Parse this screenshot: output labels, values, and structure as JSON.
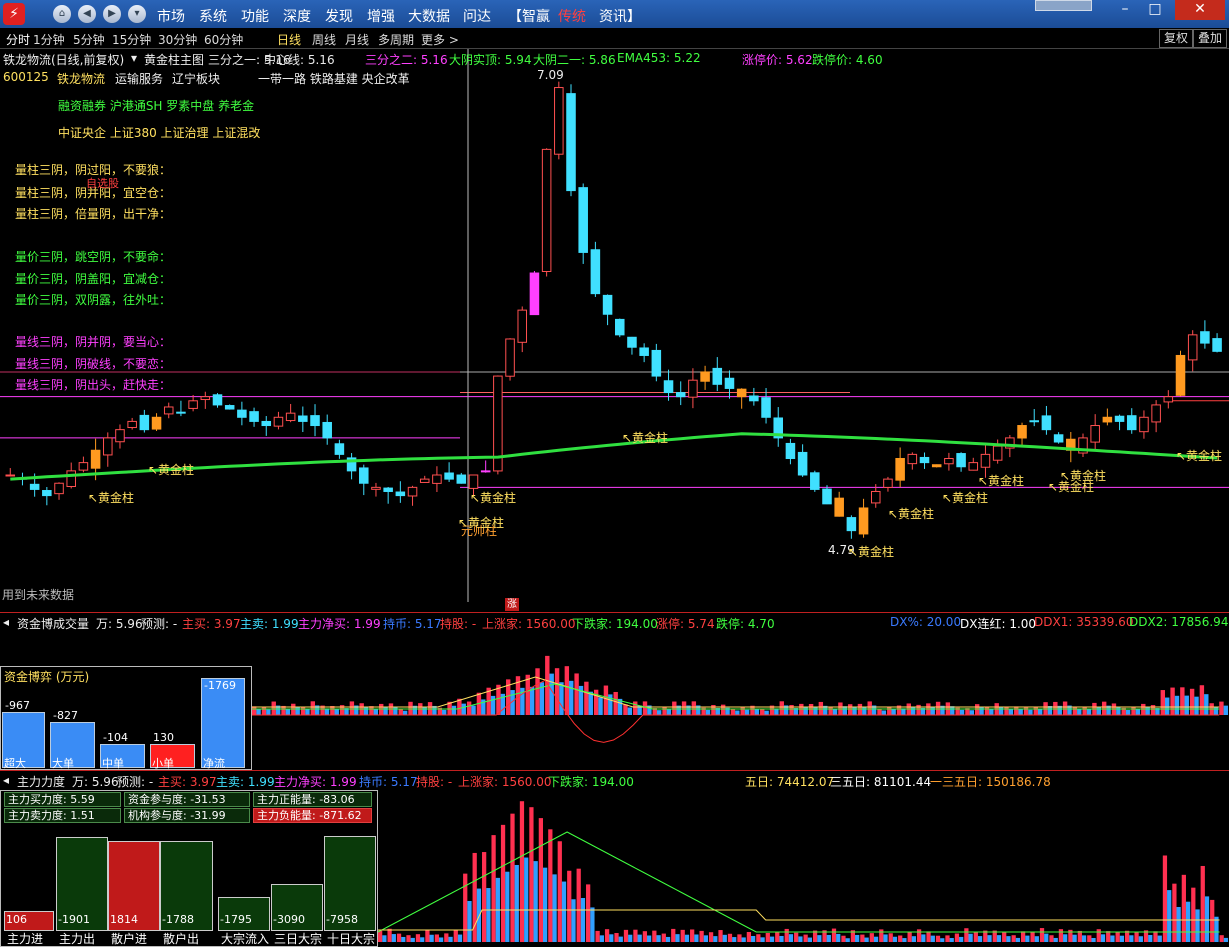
{
  "menu": {
    "items": [
      "市场",
      "系统",
      "功能",
      "深度",
      "发现",
      "增强",
      "大数据",
      "问达"
    ],
    "bracket_items": [
      "【智赢",
      "传统",
      "资讯】"
    ]
  },
  "periods": {
    "items": [
      "分时",
      "1分钟",
      "5分钟",
      "15分钟",
      "30分钟",
      "60分钟",
      "日线",
      "周线",
      "月线",
      "多周期",
      "更多 >"
    ],
    "right_buttons": [
      "复权",
      "叠加"
    ]
  },
  "main": {
    "stock_title": "铁龙物流(日线,前复权)",
    "indicator": "黄金柱主图",
    "ind_values": [
      {
        "label": "三分之一: 5.16",
        "color": "#e8e8e8"
      },
      {
        "label": "中心线: 5.16",
        "color": "#e8e8e8"
      },
      {
        "label": "三分之二: 5.16",
        "color": "#ff40ff"
      },
      {
        "label": "大阴实顶: 5.94",
        "color": "#40ff40"
      },
      {
        "label": "大阴二一: 5.86",
        "color": "#40ff40"
      },
      {
        "label": "EMA453: 5.22",
        "color": "#40ff40"
      }
    ],
    "limit_up": "涨停价: 5.62",
    "limit_down": "跌停价: 4.60",
    "code": "600125",
    "name": "铁龙物流",
    "sector1": "运输服务",
    "sector2": "辽宁板块",
    "tags1": "一带一路 铁路基建 央企改革",
    "tags2": "融资融券 沪港通SH 罗素中盘 养老金",
    "tags3": "中证央企 上证380 上证治理 上证混改",
    "yellow_rules": [
      "量柱三阴，阴过阳，不要狼：",
      "量柱三阴，阴并阳，宜空仓：",
      "量柱三阴，倍量阴，出干净："
    ],
    "green_rules": [
      "量价三阴，跳空阴，不要命：",
      "量价三阴，阴盖阳，宜减仓：",
      "量价三阴，双阴露，往外吐："
    ],
    "magenta_rules": [
      "量线三阴，阴并阴，要当心：",
      "量线三阴，阴破线，不要恋：",
      "量线三阴，阴出头，赶快走："
    ],
    "overlay_red": "自选股",
    "high_label": "7.09",
    "low_label": "4.79",
    "gold_label": "黄金柱",
    "yuanshuai_label": "元帅柱",
    "future_note": "用到未来数据",
    "zhang_marker": "涨"
  },
  "panel2": {
    "title": "资金博成交量",
    "wan": "万: 5.96",
    "yuce": "预测: -",
    "values": [
      {
        "label": "主买: 3.97",
        "color": "#ff4040"
      },
      {
        "label": "主卖: 1.99",
        "color": "#40e0ff"
      },
      {
        "label": "主力净买: 1.99",
        "color": "#ff40ff"
      },
      {
        "label": "持币: 5.17",
        "color": "#3a7aff"
      },
      {
        "label": "持股: -",
        "color": "#ff4040"
      },
      {
        "label": "上涨家: 1560.00",
        "color": "#ff4040"
      },
      {
        "label": "下跌家: 194.00",
        "color": "#40ff40"
      },
      {
        "label": "涨停: 5.74",
        "color": "#ff4040"
      },
      {
        "label": "跌停: 4.70",
        "color": "#40ff40"
      }
    ],
    "dx": [
      {
        "label": "DX%: 20.00",
        "color": "#3a7aff"
      },
      {
        "label": "DX连红: 1.00",
        "color": "#ffffff"
      },
      {
        "label": "DDX1: 35339.60",
        "color": "#ff4040"
      },
      {
        "label": "DDX2: 17856.94",
        "color": "#40ff40"
      }
    ],
    "box_title": "资金博弈 (万元)",
    "bars": [
      {
        "label": "超大",
        "value": "-967",
        "color": "#3a8cf5"
      },
      {
        "label": "大单",
        "value": "-827",
        "color": "#3a8cf5"
      },
      {
        "label": "中单",
        "value": "-104",
        "color": "#3a8cf5"
      },
      {
        "label": "小单",
        "value": "130",
        "color": "#ff2020"
      },
      {
        "label": "净流",
        "value": "-1769",
        "color": "#3a8cf5"
      }
    ]
  },
  "panel3": {
    "title": "主力力度",
    "wan": "万: 5.96",
    "yuce": "预测: -",
    "values": [
      {
        "label": "主买: 3.97",
        "color": "#ff4040"
      },
      {
        "label": "主卖: 1.99",
        "color": "#40e0ff"
      },
      {
        "label": "主力净买: 1.99",
        "color": "#ff40ff"
      },
      {
        "label": "持币: 5.17",
        "color": "#3a7aff"
      },
      {
        "label": "持股: -",
        "color": "#ff4040"
      },
      {
        "label": "上涨家: 1560.00",
        "color": "#ff4040"
      },
      {
        "label": "下跌家: 194.00",
        "color": "#40ff40"
      }
    ],
    "flows": [
      {
        "label": "五日: 74412.07",
        "color": "#ffe060"
      },
      {
        "label": "三五日: 81101.44",
        "color": "#ffffff"
      },
      {
        "label": "一三五日: 150186.78",
        "color": "#ffa030"
      }
    ],
    "grid": [
      [
        "主力买力度: 5.59",
        "资金参与度: -31.53",
        "主力正能量: -83.06"
      ],
      [
        "主力卖力度: 1.51",
        "机构参与度: -31.99",
        "主力负能量: -871.62"
      ]
    ],
    "bars": [
      {
        "label": "主力进",
        "value": "106",
        "color": "#c01a1a"
      },
      {
        "label": "主力出",
        "value": "-1901",
        "color": "#0a3a0a"
      },
      {
        "label": "散户进",
        "value": "1814",
        "color": "#c01a1a"
      },
      {
        "label": "散户出",
        "value": "-1788",
        "color": "#0a3a0a"
      },
      {
        "label": "大宗流入",
        "value": "-1795",
        "color": "#0a3a0a"
      },
      {
        "label": "三日大宗",
        "value": "-3090",
        "color": "#0a3a0a"
      },
      {
        "label": "十日大宗",
        "value": "-7958",
        "color": "#0a3a0a"
      }
    ]
  }
}
